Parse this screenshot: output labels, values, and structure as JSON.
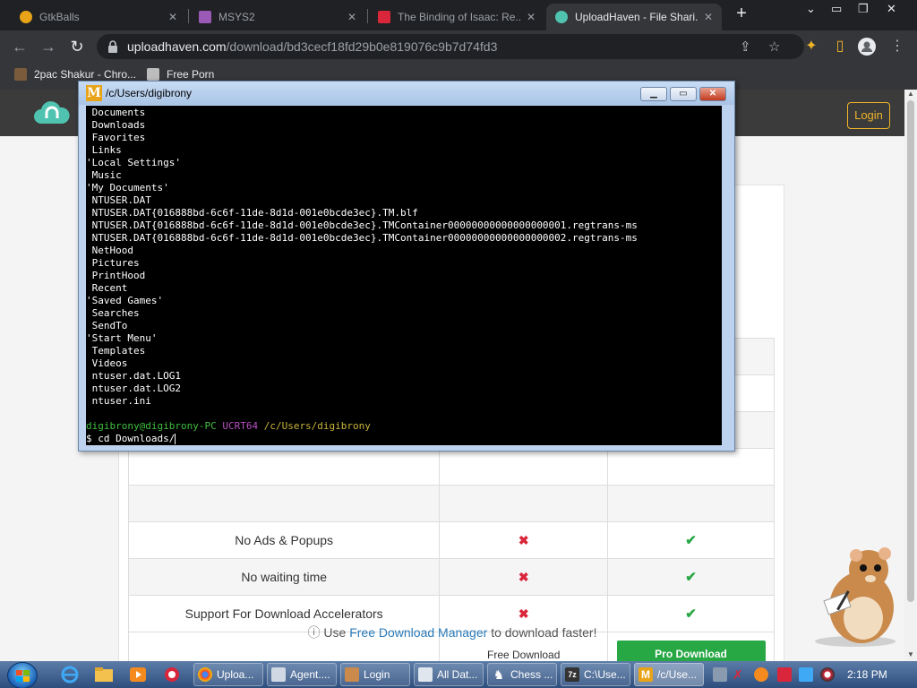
{
  "browser": {
    "tabs": [
      {
        "title": "GtkBalls",
        "favicon_color": "#e8a317",
        "active": false
      },
      {
        "title": "MSYS2",
        "favicon_color": "#9b59b6",
        "active": false
      },
      {
        "title": "The Binding of Isaac: Re...",
        "favicon_color": "#d9263a",
        "active": false
      },
      {
        "title": "UploadHaven - File Shari...",
        "favicon_color": "#4fc3b0",
        "active": true
      }
    ],
    "url_domain": "uploadhaven.com",
    "url_path": "/download/bd3cecf18fd29b0e819076c9b7d74fd3",
    "bookmarks": [
      {
        "label": "2pac Shakur - Chro..."
      },
      {
        "label": "Free Porn"
      }
    ]
  },
  "site": {
    "login_label": "Login",
    "accent_color": "#f0b429",
    "table": {
      "rows": [
        {
          "feature": "No Ads & Popups",
          "free": "cross",
          "pro": "check"
        },
        {
          "feature": "No waiting time",
          "free": "cross",
          "pro": "check"
        },
        {
          "feature": "Support For Download Accelerators",
          "free": "cross",
          "pro": "check"
        }
      ],
      "free_download_label": "Free Download",
      "pro_download_label": "Pro Download"
    },
    "note_prefix": "Use",
    "note_link": "Free Download Manager",
    "note_suffix": "to download faster!"
  },
  "terminal": {
    "title": "/c/Users/digibrony",
    "lines": [
      " Documents",
      " Downloads",
      " Favorites",
      " Links",
      "'Local Settings'",
      " Music",
      "'My Documents'",
      " NTUSER.DAT",
      " NTUSER.DAT{016888bd-6c6f-11de-8d1d-001e0bcde3ec}.TM.blf",
      " NTUSER.DAT{016888bd-6c6f-11de-8d1d-001e0bcde3ec}.TMContainer00000000000000000001.regtrans-ms",
      " NTUSER.DAT{016888bd-6c6f-11de-8d1d-001e0bcde3ec}.TMContainer00000000000000000002.regtrans-ms",
      " NetHood",
      " Pictures",
      " PrintHood",
      " Recent",
      "'Saved Games'",
      " Searches",
      " SendTo",
      "'Start Menu'",
      " Templates",
      " Videos",
      " ntuser.dat.LOG1",
      " ntuser.dat.LOG2",
      " ntuser.ini",
      ""
    ],
    "prompt_user": "digibrony@digibrony-PC",
    "prompt_env": "UCRT64",
    "prompt_path": "/c/Users/digibrony",
    "command": "$ cd Downloads/"
  },
  "taskbar": {
    "tasks": [
      {
        "label": "Uploa...",
        "icon_color": "#e0b130",
        "active": false
      },
      {
        "label": "Agent....",
        "icon_color": "#cfd8e3",
        "active": false
      },
      {
        "label": "Login",
        "icon_color": "#c98a4b",
        "active": false
      },
      {
        "label": "All Dat...",
        "icon_color": "#dfe6ee",
        "active": false
      },
      {
        "label": "Chess ...",
        "icon_color": "#ffffff",
        "active": false
      },
      {
        "label": "C:\\Use...",
        "icon_color": "#333333",
        "active": false
      },
      {
        "label": "/c/Use...",
        "icon_color": "#e8a317",
        "active": true
      }
    ],
    "clock": "2:18 PM"
  }
}
